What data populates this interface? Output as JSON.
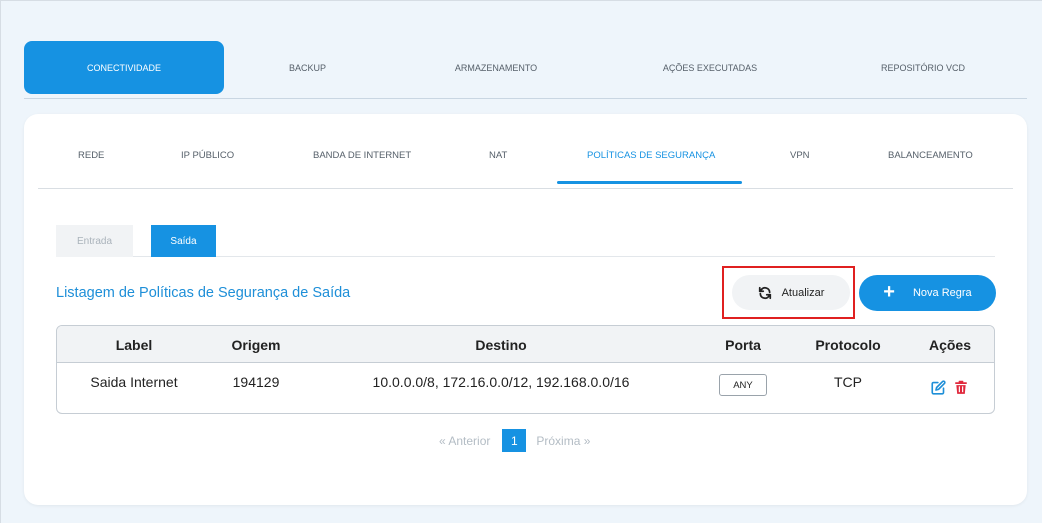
{
  "top_tabs": [
    {
      "label": "CONECTIVIDADE",
      "active": true
    },
    {
      "label": "BACKUP",
      "active": false
    },
    {
      "label": "ARMAZENAMENTO",
      "active": false
    },
    {
      "label": "AÇÕES EXECUTADAS",
      "active": false
    },
    {
      "label": "REPOSITÓRIO VCD",
      "active": false
    }
  ],
  "sub_tabs": [
    {
      "label": "REDE"
    },
    {
      "label": "IP PÚBLICO"
    },
    {
      "label": "BANDA DE INTERNET"
    },
    {
      "label": "NAT"
    },
    {
      "label": "POLÍTICAS DE SEGURANÇA",
      "active": true
    },
    {
      "label": "VPN"
    },
    {
      "label": "BALANCEAMENTO"
    }
  ],
  "direction_tabs": {
    "inbound": "Entrada",
    "outbound": "Saída",
    "active": "outbound"
  },
  "listing_title": "Listagem de Políticas de Segurança de Saída",
  "buttons": {
    "refresh": "Atualizar",
    "new_rule": "Nova Regra"
  },
  "table": {
    "headers": [
      "Label",
      "Origem",
      "Destino",
      "Porta",
      "Protocolo",
      "Ações"
    ],
    "rows": [
      {
        "label": "Saida Internet",
        "origem": "194129",
        "destino": "10.0.0.0/8, 172.16.0.0/12, 192.168.0.0/16",
        "porta": "ANY",
        "protocolo": "TCP"
      }
    ]
  },
  "pagination": {
    "prev": "«  Anterior",
    "current": "1",
    "next": "Próxima  »"
  },
  "colors": {
    "accent": "#1692e2",
    "edit_icon": "#1e8fd8",
    "delete_icon": "#e0283c",
    "highlight": "#e02020"
  }
}
